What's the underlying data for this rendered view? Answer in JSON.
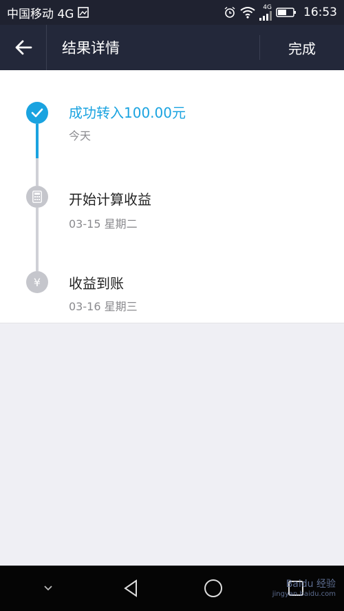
{
  "status_bar": {
    "carrier": "中国移动 4G",
    "time": "16:53",
    "network": "4G",
    "icons": [
      "image-icon",
      "alarm-icon",
      "wifi-icon",
      "signal-icon",
      "battery-icon"
    ]
  },
  "nav": {
    "back_icon": "arrow-left-icon",
    "title": "结果详情",
    "done_label": "完成"
  },
  "timeline": {
    "steps": [
      {
        "icon": "check-icon",
        "title": "成功转入100.00元",
        "subtitle": "今天",
        "state": "done"
      },
      {
        "icon": "calculator-icon",
        "title": "开始计算收益",
        "subtitle": "03-15 星期二",
        "state": "pending"
      },
      {
        "icon": "yen-icon",
        "title": "收益到账",
        "subtitle": "03-16 星期三",
        "state": "pending"
      }
    ],
    "yen_symbol": "¥"
  },
  "bottom_nav": {
    "icons": [
      "chevron-down-icon",
      "back-triangle-icon",
      "home-circle-icon",
      "recent-square-icon"
    ]
  },
  "watermark": {
    "text": "Baidu 经验",
    "url": "jingyan.baidu.com"
  },
  "colors": {
    "accent": "#1aa3e0",
    "nav_bg": "#23283a",
    "page_bg": "#efeff4",
    "inactive_node": "#c5c6cc"
  }
}
